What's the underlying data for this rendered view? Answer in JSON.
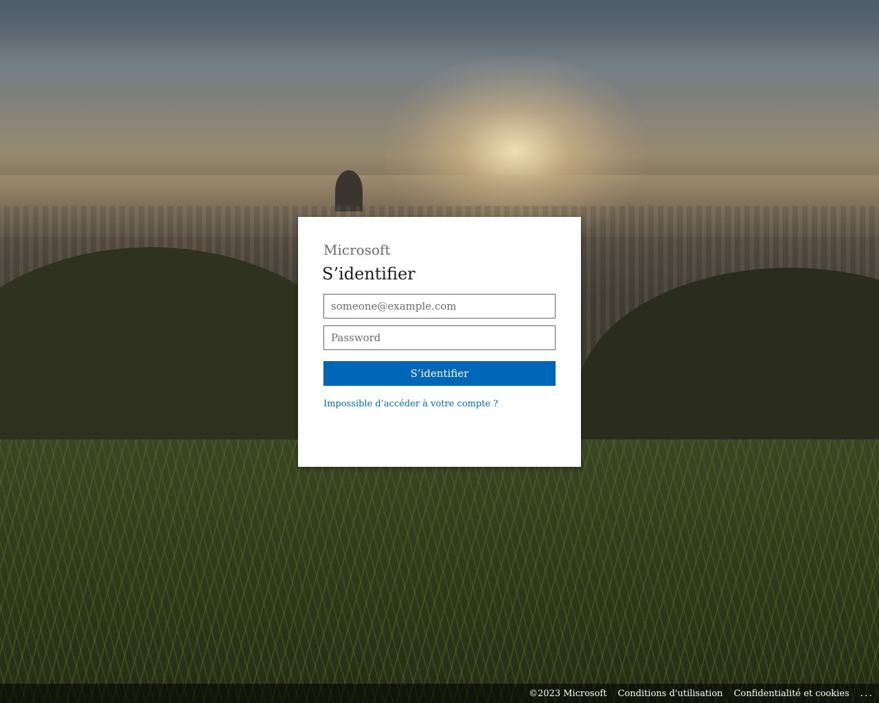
{
  "login": {
    "logo_text": "Microsoft",
    "title": "S’identifier",
    "email_placeholder": "someone@example.com",
    "password_placeholder": "Password",
    "submit_label": "S’identifier",
    "help_link": "Impossible d’accéder à votre compte ?"
  },
  "footer": {
    "copyright": "©2023 Microsoft",
    "terms": "Conditions d'utilisation",
    "privacy": "Confidentialité et cookies",
    "more": "..."
  },
  "colors": {
    "accent": "#0067b8",
    "logo_text": "#6b6b6b",
    "footer_bg": "rgba(0,0,0,0.55)"
  }
}
